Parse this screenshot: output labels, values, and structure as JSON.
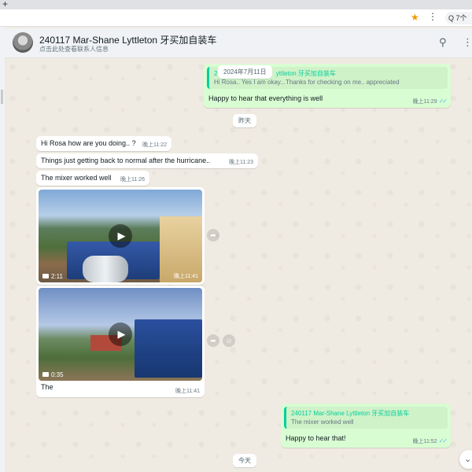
{
  "browser": {
    "new_tab": "+",
    "bookmark_icon": "star-icon",
    "menu_icon": "kebab-icon",
    "search_snippet": "Q 7个"
  },
  "header": {
    "title": "240117 Mar-Shane Lyttleton 牙买加自装车",
    "subtitle": "点击此处查看联系人信息",
    "icons": [
      "search-icon",
      "more-icon"
    ]
  },
  "date_labels": {
    "top": "2024年7月11日",
    "yesterday": "昨天",
    "today": "今天"
  },
  "messages": {
    "m1": {
      "direction": "out",
      "quote_author": "240117 Mar-Shane Lyttleton 牙买加自装车",
      "quote_author_visible": "yttleton 牙买加自装车",
      "quote_author_prefix": "24",
      "quote_text": "Hi Rosa.. Yes I am okay...Thanks for checking on me.. appreciated",
      "text": "Happy to hear that everything is well",
      "time": "晚上11:29"
    },
    "m2": {
      "direction": "in",
      "text": "Hi Rosa how are you doing.. ?",
      "time": "晚上11:22"
    },
    "m3": {
      "direction": "in",
      "text": "Things just getting back to normal after the hurricane..",
      "time": "晚上11:23"
    },
    "m4": {
      "direction": "in",
      "text": "The mixer worked well",
      "time": "晚上11:26"
    },
    "v1": {
      "duration": "2:11",
      "time": "晚上11:41"
    },
    "v2": {
      "duration": "0:35",
      "caption": "The",
      "time": "晚上11:41"
    },
    "m5": {
      "direction": "out",
      "quote_author": "240117 Mar-Shane Lyttleton 牙买加自装车",
      "quote_text": "The mixer worked well",
      "text": "Happy to hear that!",
      "time": "晚上11:52"
    }
  },
  "glyphs": {
    "ticks": "✓✓",
    "play": "▶",
    "forward": "➦",
    "emoji": "☺",
    "chevron": "⌄",
    "search": "⚲",
    "more": "⋮"
  }
}
